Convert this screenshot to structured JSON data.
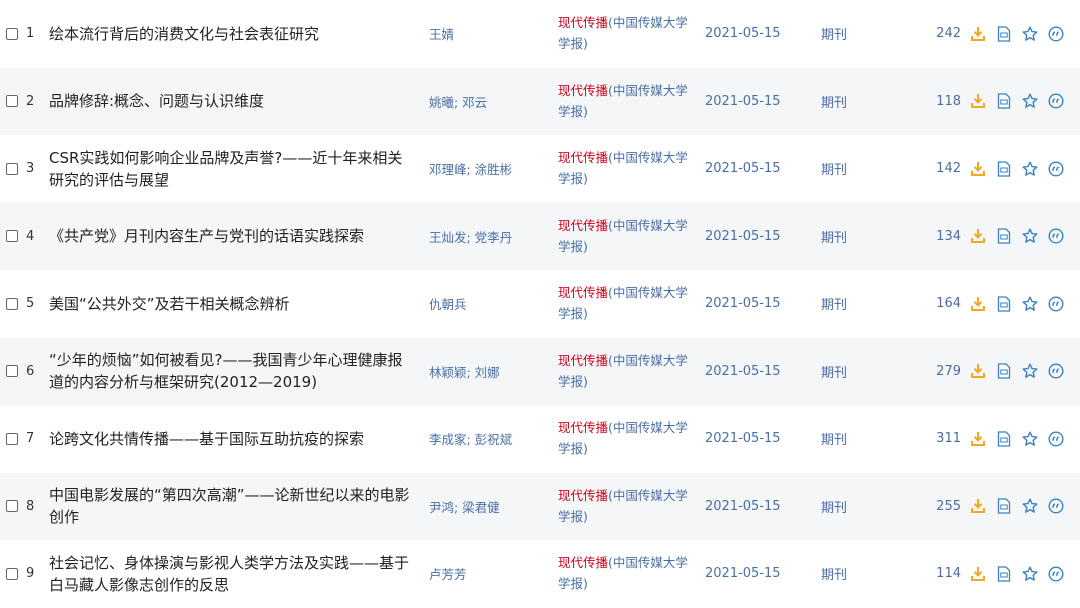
{
  "colors": {
    "download": "#f5a623",
    "source_highlight": "#d0021b",
    "meta_text": "#4a6fa5",
    "icon_blue": "#3b82c4"
  },
  "icons": [
    "download-icon",
    "html-read-icon",
    "favorite-star-icon",
    "cite-icon"
  ],
  "rows": [
    {
      "num": "1",
      "title": "绘本流行背后的消费文化与社会表征研究",
      "authors": "王婧",
      "source_hl": "现代传播",
      "source_rest": "(中国传媒大学学报)",
      "date": "2021-05-15",
      "type": "期刊",
      "downloads": "242"
    },
    {
      "num": "2",
      "title": "品牌修辞:概念、问题与认识维度",
      "authors": "姚曦; 邓云",
      "source_hl": "现代传播",
      "source_rest": "(中国传媒大学学报)",
      "date": "2021-05-15",
      "type": "期刊",
      "downloads": "118"
    },
    {
      "num": "3",
      "title": "CSR实践如何影响企业品牌及声誉?——近十年来相关研究的评估与展望",
      "authors": "邓理峰; 涂胜彬",
      "source_hl": "现代传播",
      "source_rest": "(中国传媒大学学报)",
      "date": "2021-05-15",
      "type": "期刊",
      "downloads": "142"
    },
    {
      "num": "4",
      "title": "《共产党》月刊内容生产与党刊的话语实践探索",
      "authors": "王灿发; 党李丹",
      "source_hl": "现代传播",
      "source_rest": "(中国传媒大学学报)",
      "date": "2021-05-15",
      "type": "期刊",
      "downloads": "134"
    },
    {
      "num": "5",
      "title": "美国“公共外交”及若干相关概念辨析",
      "authors": "仇朝兵",
      "source_hl": "现代传播",
      "source_rest": "(中国传媒大学学报)",
      "date": "2021-05-15",
      "type": "期刊",
      "downloads": "164"
    },
    {
      "num": "6",
      "title": "“少年的烦恼”如何被看见?——我国青少年心理健康报道的内容分析与框架研究(2012—2019)",
      "authors": "林颖颖; 刘娜",
      "source_hl": "现代传播",
      "source_rest": "(中国传媒大学学报)",
      "date": "2021-05-15",
      "type": "期刊",
      "downloads": "279"
    },
    {
      "num": "7",
      "title": "论跨文化共情传播——基于国际互助抗疫的探索",
      "authors": "李成家; 彭祝斌",
      "source_hl": "现代传播",
      "source_rest": "(中国传媒大学学报)",
      "date": "2021-05-15",
      "type": "期刊",
      "downloads": "311"
    },
    {
      "num": "8",
      "title": "中国电影发展的“第四次高潮”——论新世纪以来的电影创作",
      "authors": "尹鸿; 梁君健",
      "source_hl": "现代传播",
      "source_rest": "(中国传媒大学学报)",
      "date": "2021-05-15",
      "type": "期刊",
      "downloads": "255"
    },
    {
      "num": "9",
      "title": "社会记忆、身体操演与影视人类学方法及实践——基于白马藏人影像志创作的反思",
      "authors": "卢芳芳",
      "source_hl": "现代传播",
      "source_rest": "(中国传媒大学学报)",
      "date": "2021-05-15",
      "type": "期刊",
      "downloads": "114"
    }
  ]
}
